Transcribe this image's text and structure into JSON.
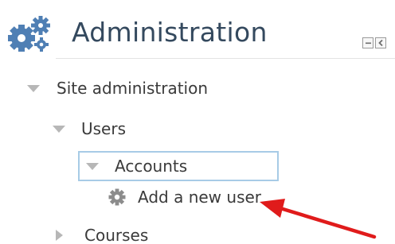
{
  "block": {
    "title": "Administration",
    "icon": "gears-icon",
    "controls": [
      {
        "name": "collapse-block-icon"
      },
      {
        "name": "dock-block-icon"
      }
    ]
  },
  "tree": {
    "site_administration": "Site administration",
    "users": "Users",
    "accounts": "Accounts",
    "add_new_user": "Add a new user",
    "courses": "Courses"
  },
  "colors": {
    "title": "#34495e",
    "icon": "#4f7fb4",
    "arrow": "#e01b1b",
    "highlight_border": "#a7cbe6",
    "triangle": "#b7b7b7"
  }
}
